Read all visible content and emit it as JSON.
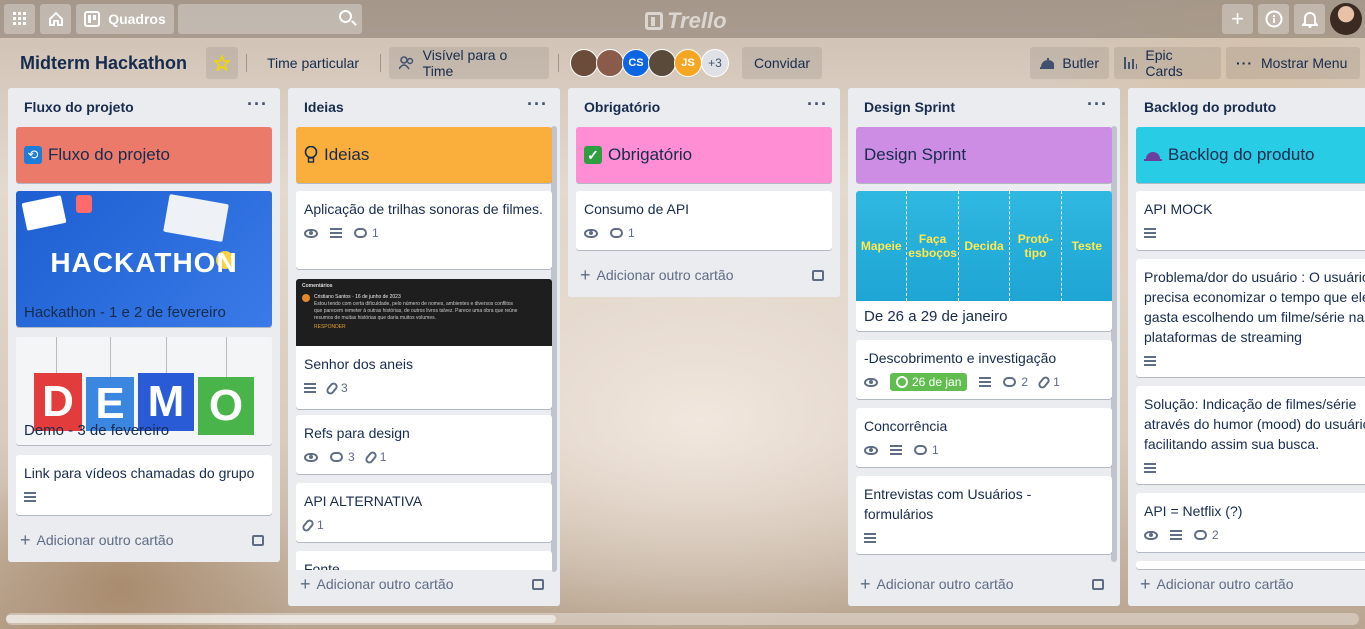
{
  "topbar": {
    "boards_label": "Quadros",
    "logo": "Trello"
  },
  "board": {
    "title": "Midterm Hackathon",
    "team": "Time particular",
    "visibility": "Visível para o Time",
    "invite": "Convidar",
    "more_members": "+3",
    "members": [
      {
        "initials": "",
        "color": "#6b4b3a"
      },
      {
        "initials": "",
        "color": "#8a5a4a"
      },
      {
        "initials": "CS",
        "color": "#0c66e4"
      },
      {
        "initials": "",
        "color": "#5a4a3a"
      },
      {
        "initials": "JS",
        "color": "#f5a623"
      }
    ],
    "butler": "Butler",
    "epic": "Epic Cards",
    "menu": "Mostrar Menu"
  },
  "add_card": "Adicionar outro cartão",
  "lists": [
    {
      "title": "Fluxo do projeto",
      "header_card": "Fluxo do projeto",
      "header_color": "#eb7a6b",
      "cards": [
        {
          "text": "Hackathon - 1 e 2 de fevereiro",
          "image_text": "HACKATHON"
        },
        {
          "text": "Demo - 3 de fevereiro",
          "image_text": "DEMO"
        },
        {
          "text": "Link para vídeos chamadas do grupo"
        }
      ]
    },
    {
      "title": "Ideias",
      "header_card": "Ideias",
      "header_color": "#faae3c",
      "cards": [
        {
          "text": "Aplicação de trilhas sonoras de filmes.",
          "comments": "1"
        },
        {
          "text": "Senhor dos aneis",
          "attachments": "3",
          "image_lines": [
            "Comentários",
            "Cristiano Santos · 16 de junho de 2023",
            "Estou tendo com certa dificuldade, pelo número de nomes, ambientes e diversos conflitos",
            "que parecem remeter à outras histórias, de outros livros talvez. Parece uma obra que reúne",
            "resumos de muitas histórias que daria muitos volumes.",
            "RESPONDER"
          ]
        },
        {
          "text": "Refs para design",
          "comments": "3",
          "attachments": "1"
        },
        {
          "text": "API ALTERNATIVA",
          "attachments": "1"
        },
        {
          "text": "Fonte"
        }
      ]
    },
    {
      "title": "Obrigatório",
      "header_card": "Obrigatório",
      "header_color": "#ff8ed4",
      "cards": [
        {
          "text": "Consumo de API",
          "comments": "1"
        }
      ]
    },
    {
      "title": "Design Sprint",
      "header_card": "Design Sprint",
      "header_color": "#cd8de5",
      "cards": [
        {
          "text": "De 26 a 29 de janeiro",
          "image_words": [
            "Mapeie",
            "Faça esboços",
            "Decida",
            "Protó-tipo",
            "Teste"
          ]
        },
        {
          "text": "-Descobrimento e investigação",
          "due": "26 de jan",
          "comments": "2",
          "attachments": "1"
        },
        {
          "text": "Concorrência",
          "comments": "1"
        },
        {
          "text": "Entrevistas com Usuários - formulários"
        }
      ]
    },
    {
      "title": "Backlog do produto",
      "header_card": "Backlog do produto",
      "header_color": "#29cce5",
      "cards": [
        {
          "text": "API MOCK"
        },
        {
          "text": "Problema/dor do usuário : O usuário precisa economizar o tempo que ele gasta escolhendo um filme/série nas plataformas de streaming"
        },
        {
          "text": "Solução: Indicação de filmes/série através do humor (mood) do usuário facilitando assim sua busca."
        },
        {
          "text": "API = Netflix (?)",
          "comments": "2"
        }
      ]
    }
  ]
}
